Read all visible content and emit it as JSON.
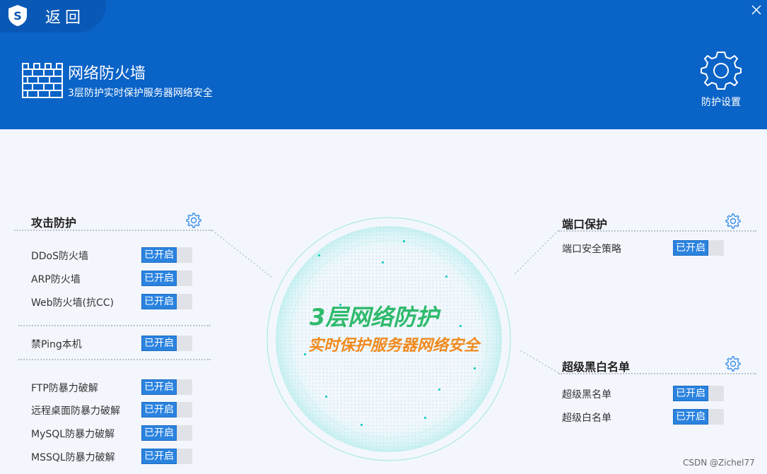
{
  "header": {
    "back_label": "返回",
    "title": "网络防火墙",
    "subtitle": "3层防护实时保护服务器网络安全",
    "settings_label": "防护设置"
  },
  "center": {
    "title": "3层网络防护",
    "subtitle": "实时保护服务器网络安全"
  },
  "attack_protection": {
    "title": "攻击防护",
    "items": [
      {
        "label": "DDoS防火墙",
        "status": "已开启"
      },
      {
        "label": "ARP防火墙",
        "status": "已开启"
      },
      {
        "label": "Web防火墙(抗CC)",
        "status": "已开启"
      },
      {
        "label": "禁Ping本机",
        "status": "已开启"
      },
      {
        "label": "FTP防暴力破解",
        "status": "已开启"
      },
      {
        "label": "远程桌面防暴力破解",
        "status": "已开启"
      },
      {
        "label": "MySQL防暴力破解",
        "status": "已开启"
      },
      {
        "label": "MSSQL防暴力破解",
        "status": "已开启"
      }
    ]
  },
  "port_protection": {
    "title": "端口保护",
    "items": [
      {
        "label": "端口安全策略",
        "status": "已开启"
      }
    ]
  },
  "blackwhite": {
    "title": "超级黑白名单",
    "items": [
      {
        "label": "超级黑名单",
        "status": "已开启"
      },
      {
        "label": "超级白名单",
        "status": "已开启"
      }
    ]
  },
  "watermark": "CSDN @Zichel77",
  "colors": {
    "header_bg": "#0a63c7",
    "toggle_on": "#2b83e0",
    "center_green": "#2fba6c",
    "center_orange": "#f08a1d"
  }
}
